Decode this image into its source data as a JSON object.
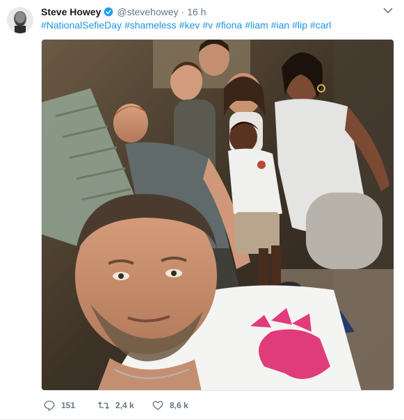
{
  "tweet": {
    "author_name": "Steve Howey",
    "handle": "@stevehowey",
    "separator": "·",
    "time": "16 h",
    "verified": true,
    "hashtags": [
      "#NationalSefieDay",
      "#shameless",
      "#kev",
      "#v",
      "#fiona",
      "#liam",
      "#ian",
      "#lip",
      "#carl"
    ]
  },
  "actions": {
    "replies": "151",
    "retweets": "2,4 k",
    "likes": "8,6 k"
  },
  "icons": {
    "verified": "verified-badge-icon",
    "caret": "chevron-down-icon",
    "reply": "reply-icon",
    "retweet": "retweet-icon",
    "like": "heart-icon"
  },
  "colors": {
    "link": "#1b95e0",
    "muted": "#657786",
    "verified": "#1da1f2"
  }
}
